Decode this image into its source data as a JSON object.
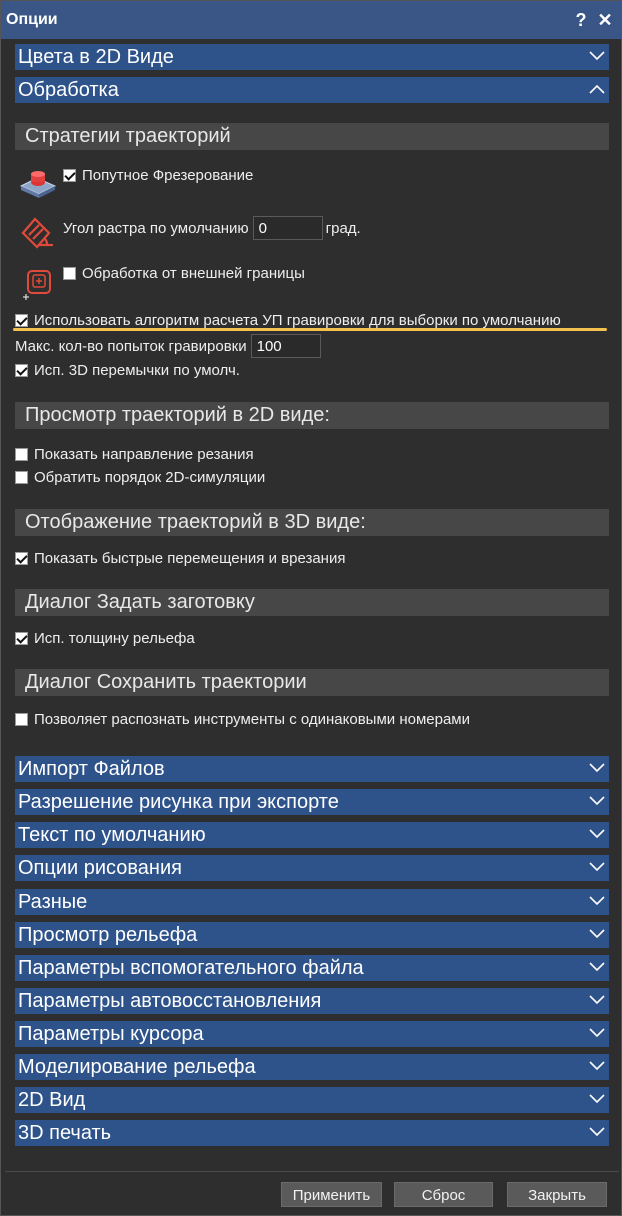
{
  "window": {
    "title": "Опции",
    "help_glyph": "?",
    "close_glyph": "✕"
  },
  "sections_top": [
    {
      "label": "Цвета в 2D Виде",
      "expanded": false
    },
    {
      "label": "Обработка",
      "expanded": true
    }
  ],
  "processing": {
    "groups": {
      "strategies": "Стратегии траекторий",
      "preview2d": "Просмотр траекторий в 2D виде:",
      "display3d": "Отображение траекторий в 3D виде:",
      "blank": "Диалог Задать заготовку",
      "save": "Диалог Сохранить траектории"
    },
    "climb_milling": {
      "label": "Попутное Фрезерование",
      "checked": true,
      "icon": "climb-milling-icon"
    },
    "raster_angle": {
      "label": "Угол растра по умолчанию",
      "value": "0",
      "unit": "град.",
      "icon": "raster-angle-icon"
    },
    "outer_boundary": {
      "label": "Обработка от внешней границы",
      "checked": false,
      "icon": "outer-boundary-icon"
    },
    "engrave_algo": {
      "label": "Использовать алгоритм расчета УП гравировки для выборки по умолчанию",
      "checked": true
    },
    "max_attempts": {
      "label": "Макс. кол-во попыток гравировки",
      "value": "100"
    },
    "bridges_3d": {
      "label": "Исп. 3D перемычки по умолч.",
      "checked": true
    },
    "show_direction": {
      "label": "Показать направление резания",
      "checked": false
    },
    "reverse_order": {
      "label": "Обратить порядок 2D-симуляции",
      "checked": false
    },
    "show_rapids": {
      "label": "Показать быстрые перемещения и врезания",
      "checked": true
    },
    "relief_thickness": {
      "label": "Исп. толщину рельефа",
      "checked": true
    },
    "same_numbers": {
      "label": "Позволяет распознать инструменты с одинаковыми номерами",
      "checked": false
    }
  },
  "sections_bottom": [
    {
      "label": "Импорт Файлов"
    },
    {
      "label": "Разрешение рисунка при экспорте"
    },
    {
      "label": "Текст по умолчанию"
    },
    {
      "label": "Опции рисования"
    },
    {
      "label": "Разные"
    },
    {
      "label": "Просмотр рельефа"
    },
    {
      "label": "Параметры вспомогательного файла"
    },
    {
      "label": "Параметры автовосстановления"
    },
    {
      "label": "Параметры курсора"
    },
    {
      "label": "Моделирование рельефа"
    },
    {
      "label": "2D Вид"
    },
    {
      "label": "3D печать"
    }
  ],
  "footer": {
    "apply": "Применить",
    "reset": "Сброс",
    "close": "Закрыть"
  },
  "colors": {
    "titlebar": "#3a5687",
    "section": "#2e538a",
    "group": "#474747",
    "highlight": "#f2c14e",
    "background": "#2e2e2e"
  }
}
